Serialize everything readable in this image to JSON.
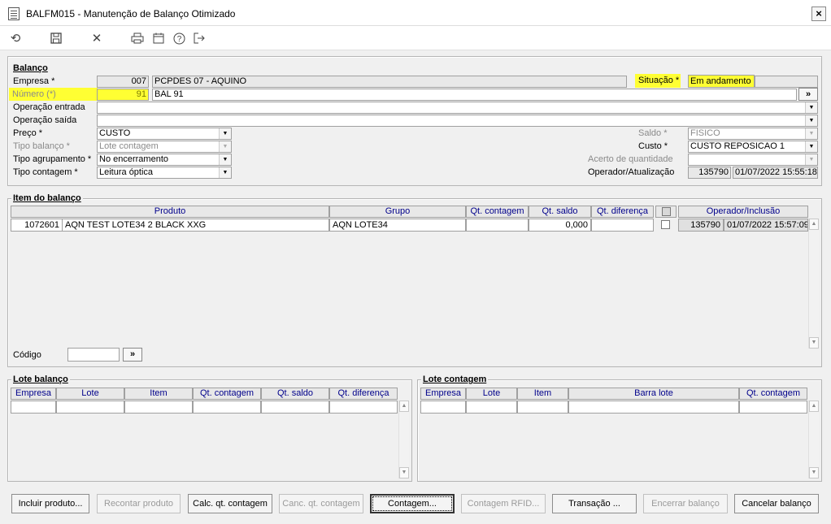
{
  "window": {
    "title": "BALFM015 - Manutenção de Balanço Otimizado",
    "close": "×"
  },
  "toolbar": {
    "icons": [
      "refresh-icon",
      "save-icon",
      "cancel-icon",
      "print-icon",
      "calendar-icon",
      "help-icon",
      "exit-icon"
    ]
  },
  "balanco": {
    "group_title": "Balanço",
    "empresa_label": "Empresa *",
    "empresa_code": "007",
    "empresa_name": "PCPDES 07 - AQUINO",
    "situacao_label": "Situação *",
    "situacao_value": "Em andamento",
    "numero_label": "Número (*)",
    "numero_value": "91",
    "numero_desc": "BAL 91",
    "op_entrada_label": "Operação entrada",
    "op_entrada_value": "",
    "op_saida_label": "Operação saída",
    "op_saida_value": "",
    "preco_label": "Preço *",
    "preco_value": "CUSTO",
    "saldo_label": "Saldo *",
    "saldo_value": "FISICO",
    "tipo_balanco_label": "Tipo balanço *",
    "tipo_balanco_value": "Lote contagem",
    "custo_label": "Custo *",
    "custo_value": "CUSTO REPOSICAO 1",
    "tipo_agrup_label": "Tipo agrupamento *",
    "tipo_agrup_value": "No encerramento",
    "acerto_label": "Acerto de quantidade",
    "acerto_value": "",
    "tipo_contagem_label": "Tipo contagem *",
    "tipo_contagem_value": "Leitura óptica",
    "operador_label": "Operador/Atualização",
    "operador_value": "135790",
    "atualizacao_value": "01/07/2022 15:55:18",
    "lookup": "»"
  },
  "item": {
    "group_title": "Item do balanço",
    "headers": [
      "Produto",
      "Grupo",
      "Qt. contagem",
      "Qt. saldo",
      "Qt. diferença",
      "",
      "Operador/Inclusão"
    ],
    "row": {
      "codigo": "1072601",
      "produto": "AQN TEST LOTE34 2 BLACK XXG",
      "grupo": "AQN LOTE34",
      "qt_contagem": "",
      "qt_saldo": "0,000",
      "qt_diferenca": "",
      "operador": "135790",
      "inclusao": "01/07/2022 15:57:09"
    },
    "codigo_label": "Código",
    "codigo_value": "",
    "lookup": "»"
  },
  "lote_balanco": {
    "group_title": "Lote balanço",
    "headers": [
      "Empresa",
      "Lote",
      "Item",
      "Qt. contagem",
      "Qt. saldo",
      "Qt. diferença"
    ]
  },
  "lote_contagem": {
    "group_title": "Lote contagem",
    "headers": [
      "Empresa",
      "Lote",
      "Item",
      "Barra lote",
      "Qt. contagem"
    ]
  },
  "buttons": {
    "incluir": "Incluir produto...",
    "recontar": "Recontar produto",
    "calc": "Calc. qt. contagem",
    "canc": "Canc. qt. contagem",
    "contagem": "Contagem...",
    "rfid": "Contagem RFID...",
    "transacao": "Transação ...",
    "encerrar": "Encerrar balanço",
    "cancelar": "Cancelar balanço"
  }
}
